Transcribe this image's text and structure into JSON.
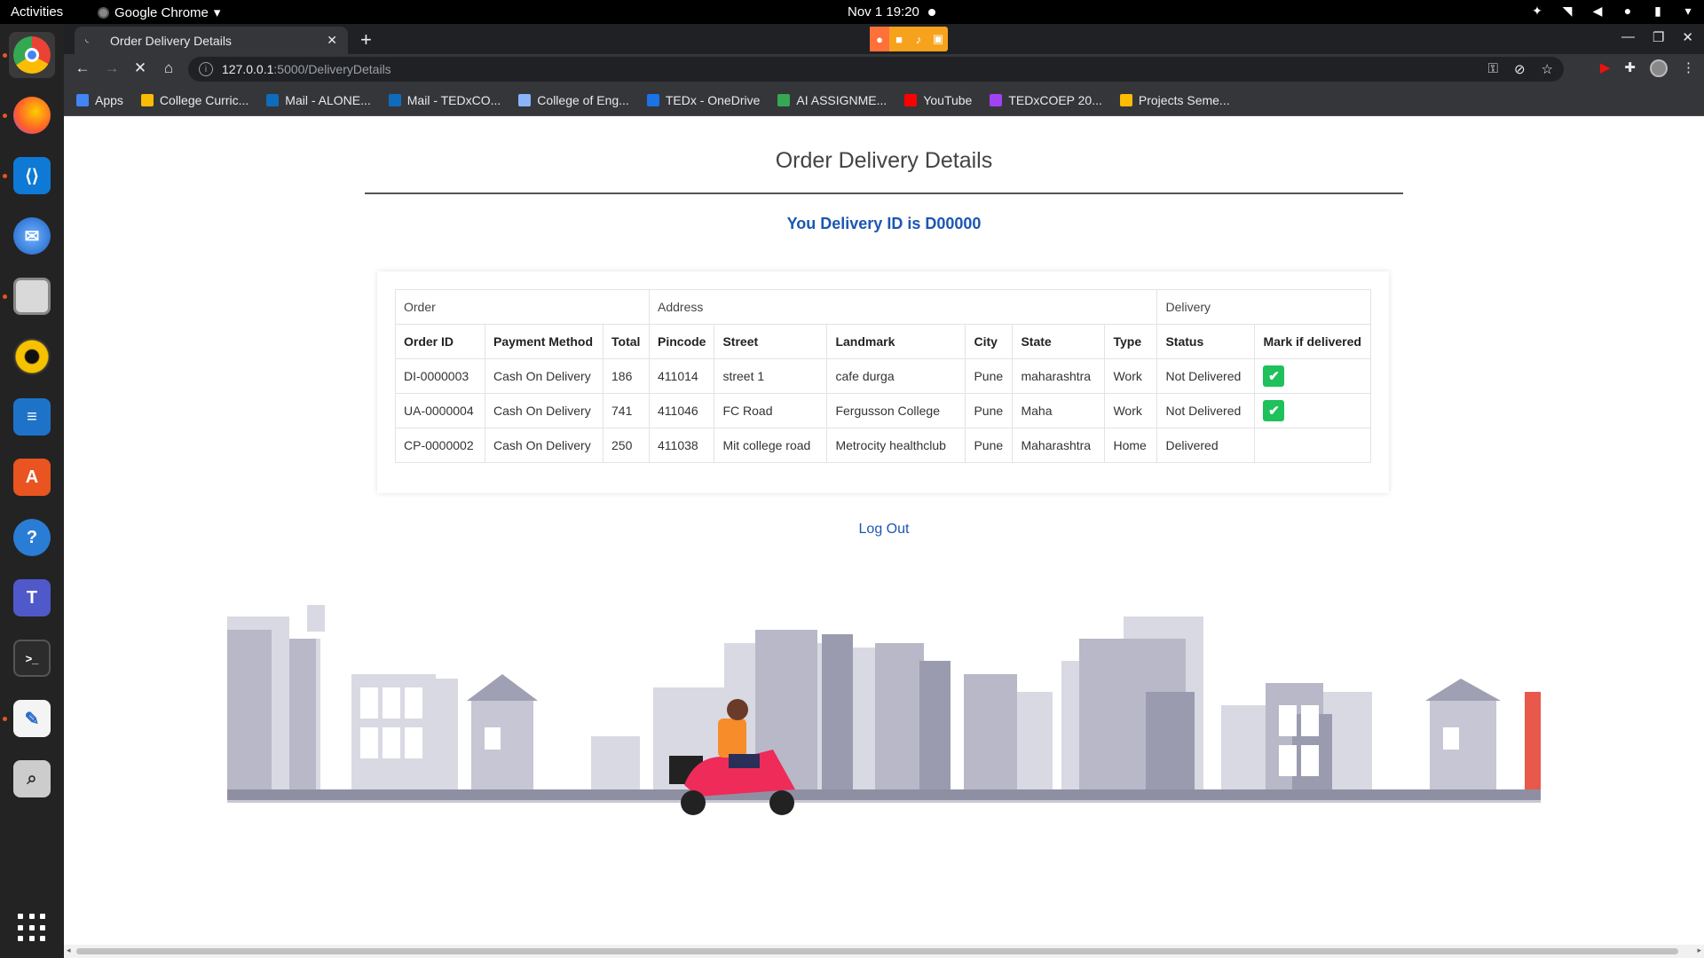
{
  "system": {
    "activities": "Activities",
    "app_menu": "Google Chrome",
    "clock": "Nov 1  19:20"
  },
  "browser": {
    "tab_title": "Order Delivery Details",
    "url_host": "127.0.0.1",
    "url_path": ":5000/DeliveryDetails",
    "bookmarks": [
      {
        "label": "Apps",
        "icon": "apps-grid-icon",
        "color": "#4285f4"
      },
      {
        "label": "College Curric...",
        "icon": "google-drive-icon",
        "color": "#fbbc04"
      },
      {
        "label": "Mail - ALONE...",
        "icon": "outlook-icon",
        "color": "#0f6cbd"
      },
      {
        "label": "Mail - TEDxCO...",
        "icon": "outlook-icon",
        "color": "#0f6cbd"
      },
      {
        "label": "College of Eng...",
        "icon": "link-icon",
        "color": "#8ab4f8"
      },
      {
        "label": "TEDx - OneDrive",
        "icon": "onedrive-icon",
        "color": "#1a73e8"
      },
      {
        "label": "AI ASSIGNME...",
        "icon": "google-drive-icon",
        "color": "#34a853"
      },
      {
        "label": "YouTube",
        "icon": "youtube-icon",
        "color": "#ff0000"
      },
      {
        "label": "TEDxCOEP 20...",
        "icon": "list-icon",
        "color": "#a142f4"
      },
      {
        "label": "Projects Seme...",
        "icon": "google-drive-icon",
        "color": "#fbbc04"
      }
    ]
  },
  "page": {
    "title": "Order Delivery Details",
    "delivery_id_text": "You Delivery ID is D00000",
    "logout": "Log Out",
    "accent": "#1b57b1",
    "table": {
      "groups": [
        "Order",
        "Address",
        "Delivery"
      ],
      "headers": [
        "Order ID",
        "Payment Method",
        "Total",
        "Pincode",
        "Street",
        "Landmark",
        "City",
        "State",
        "Type",
        "Status",
        "Mark if delivered"
      ],
      "rows": [
        {
          "order_id": "DI-0000003",
          "payment": "Cash On Delivery",
          "total": "186",
          "pincode": "411014",
          "street": "street 1",
          "landmark": "cafe durga",
          "city": "Pune",
          "state": "maharashtra",
          "type": "Work",
          "status": "Not Delivered",
          "can_mark": true
        },
        {
          "order_id": "UA-0000004",
          "payment": "Cash On Delivery",
          "total": "741",
          "pincode": "411046",
          "street": "FC Road",
          "landmark": "Fergusson College",
          "city": "Pune",
          "state": "Maha",
          "type": "Work",
          "status": "Not Delivered",
          "can_mark": true
        },
        {
          "order_id": "CP-0000002",
          "payment": "Cash On Delivery",
          "total": "250",
          "pincode": "411038",
          "street": "Mit college road",
          "landmark": "Metrocity healthclub",
          "city": "Pune",
          "state": "Maharashtra",
          "type": "Home",
          "status": "Delivered",
          "can_mark": false
        }
      ]
    }
  }
}
